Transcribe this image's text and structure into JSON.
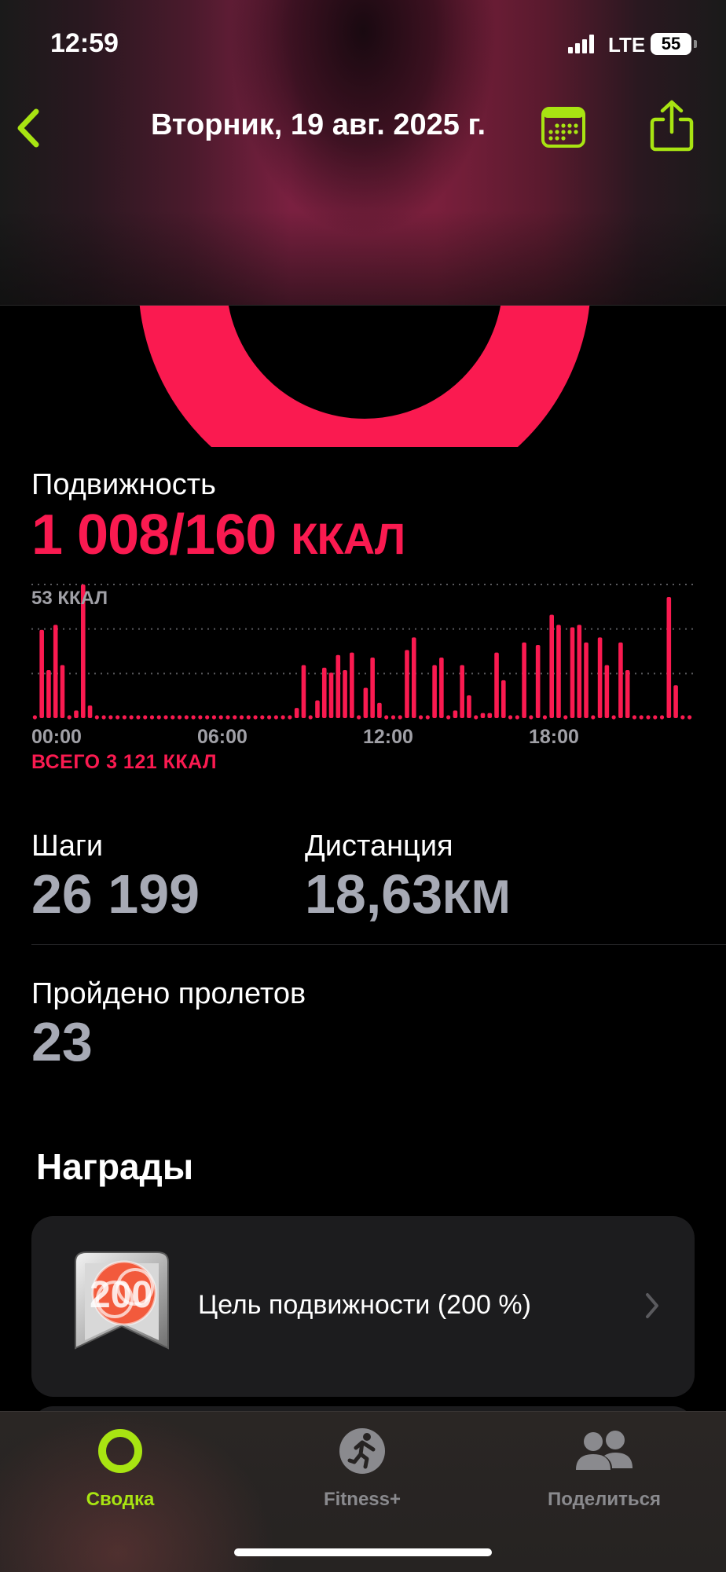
{
  "status_bar": {
    "time": "12:59",
    "network": "LTE",
    "battery": "55"
  },
  "nav": {
    "title": "Вторник, 19 авг. 2025 г."
  },
  "colors": {
    "accent": "#a8e412",
    "move": "#fa1a50",
    "secondary_text": "#a0a0a6"
  },
  "move": {
    "label": "Подвижность",
    "value": "1 008/160",
    "unit": "ККАЛ",
    "chart_max_label": "53 ККАЛ",
    "total_label": "ВСЕГО 3 121 ККАЛ",
    "ticks": [
      "00:00",
      "06:00",
      "12:00",
      "18:00"
    ]
  },
  "chart_data": {
    "type": "bar",
    "title": "",
    "xlabel": "",
    "ylabel": "",
    "ylim": [
      0,
      53
    ],
    "x_ticks": [
      "00:00",
      "06:00",
      "12:00",
      "18:00"
    ],
    "values": [
      0,
      35,
      19,
      37,
      21,
      0,
      3,
      53,
      5,
      0,
      0,
      0,
      0,
      0,
      0,
      0,
      0,
      0,
      0,
      0,
      0,
      0,
      0,
      0,
      0,
      0,
      0,
      0,
      0,
      0,
      0,
      0,
      0,
      0,
      0,
      0,
      0,
      0,
      4,
      21,
      0,
      7,
      20,
      18,
      25,
      19,
      26,
      0,
      12,
      24,
      6,
      0,
      0,
      0,
      27,
      32,
      0,
      0,
      21,
      24,
      0,
      3,
      21,
      9,
      0,
      2,
      2,
      26,
      15,
      0,
      0,
      30,
      0,
      29,
      0,
      41,
      37,
      0,
      36,
      37,
      30,
      0,
      32,
      21,
      0,
      30,
      19,
      0,
      0,
      0,
      0,
      0,
      48,
      13,
      0,
      0
    ],
    "grid": true,
    "legend": "none"
  },
  "stats": {
    "steps": {
      "label": "Шаги",
      "value": "26 199"
    },
    "distance": {
      "label": "Дистанция",
      "value": "18,63",
      "unit": "КМ"
    },
    "flights": {
      "label": "Пройдено пролетов",
      "value": "23"
    }
  },
  "awards": {
    "heading": "Награды",
    "items": [
      {
        "label": "Цель подвижности (200 %)",
        "badge_text": "200"
      }
    ]
  },
  "tabbar": {
    "tabs": [
      {
        "label": "Сводка",
        "icon": "activity-ring-icon",
        "active": true
      },
      {
        "label": "Fitness+",
        "icon": "running-figure-icon",
        "active": false
      },
      {
        "label": "Поделиться",
        "icon": "people-icon",
        "active": false
      }
    ]
  }
}
